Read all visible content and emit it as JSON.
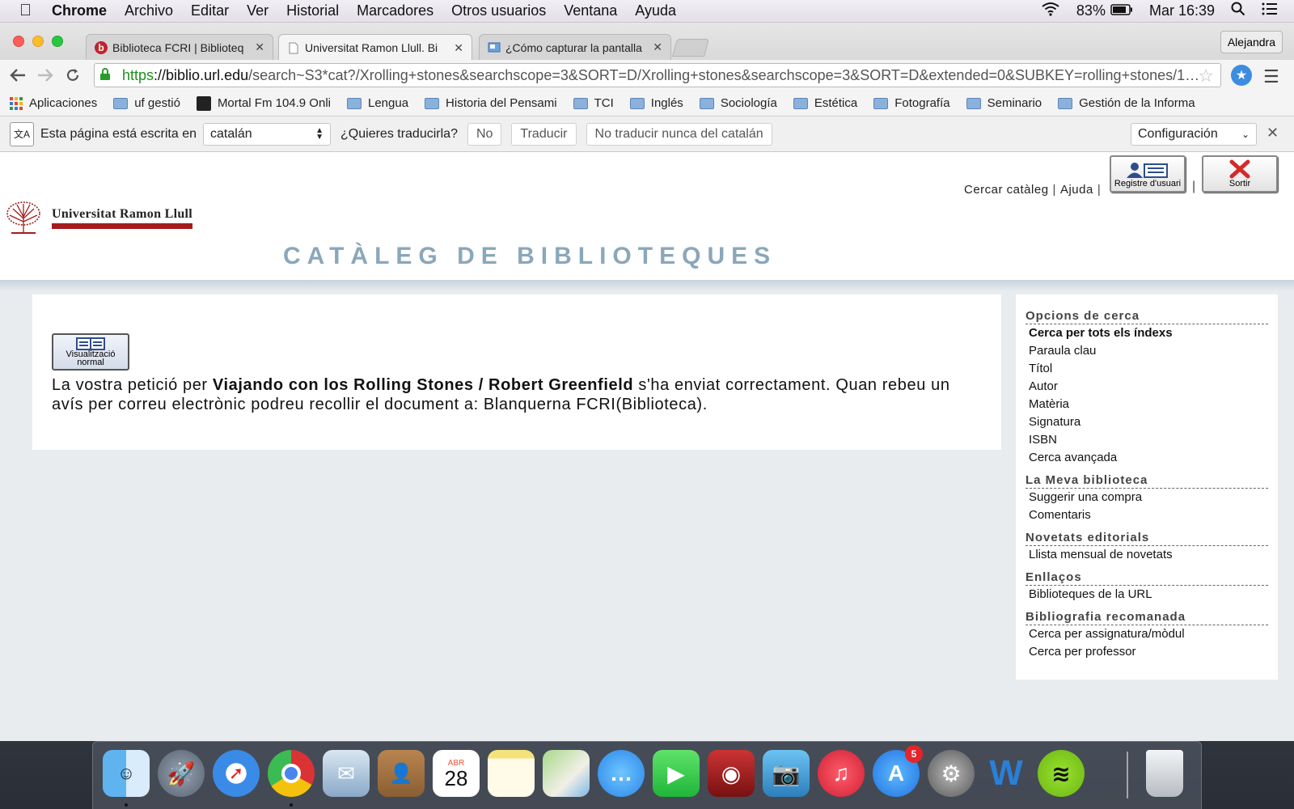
{
  "menubar": {
    "app": "Chrome",
    "items": [
      "Archivo",
      "Editar",
      "Ver",
      "Historial",
      "Marcadores",
      "Otros usuarios",
      "Ventana",
      "Ayuda"
    ],
    "battery": "83%",
    "clock": "Mar 16:39"
  },
  "tabs": [
    {
      "title": "Biblioteca FCRI | Biblioteq",
      "favicon": "b"
    },
    {
      "title": "Universitat Ramon Llull. Bi",
      "favicon": ""
    },
    {
      "title": "¿Cómo capturar la pantalla",
      "favicon": ""
    }
  ],
  "user": "Alejandra",
  "omnibox": {
    "scheme": "https",
    "host": "://biblio.url.edu",
    "path": "/search~S3*cat?/Xrolling+stones&searchscope=3&SORT=D/Xrolling+stones&searchscope=3&SORT=D&extended=0&SUBKEY=rolling+stones/1…"
  },
  "bookmarks": {
    "apps": "Aplicaciones",
    "items": [
      "uf gestió",
      "Mortal Fm 104.9 Onli",
      "Lengua",
      "Historia del Pensami",
      "TCI",
      "Inglés",
      "Sociología",
      "Estética",
      "Fotografía",
      "Seminario",
      "Gestión de la Informa"
    ]
  },
  "translate": {
    "prefix": "Esta página está escrita en",
    "language": "catalán",
    "question": "¿Quieres traducirla?",
    "no": "No",
    "translate": "Traducir",
    "never": "No traducir nunca del catalán",
    "config": "Configuración"
  },
  "header": {
    "search_link": "Cercar catàleg",
    "help_link": "Ajuda",
    "register_label": "Registre d'usuari",
    "exit_label": "Sortir",
    "university": "Universitat Ramon Llull",
    "catalog_title": "CATÀLEG DE BIBLIOTEQUES"
  },
  "main": {
    "view_label_1": "Visualització",
    "view_label_2": "normal",
    "msg_prefix": "La vostra petició per",
    "msg_title": "Viajando con los Rolling Stones / Robert Greenfield",
    "msg_suffix": "s'ha enviat correctament. Quan rebeu un avís per correu electrònic podreu recollir el document a: Blanquerna FCRI(Biblioteca)."
  },
  "sidebar": {
    "sections": [
      {
        "title": "Opcions de cerca",
        "items": [
          "Cerca per tots els índexs",
          "Paraula clau",
          "Títol",
          "Autor",
          "Matèria",
          "Signatura",
          "ISBN",
          "Cerca avançada"
        ]
      },
      {
        "title": "La Meva biblioteca",
        "items": [
          "Suggerir una compra",
          "Comentaris"
        ]
      },
      {
        "title": "Novetats editorials",
        "items": [
          "Llista mensual de novetats"
        ]
      },
      {
        "title": "Enllaços",
        "items": [
          "Biblioteques de la URL"
        ]
      },
      {
        "title": "Bibliografia recomanada",
        "items": [
          "Cerca per assignatura/mòdul",
          "Cerca per professor"
        ]
      }
    ]
  },
  "dock": {
    "calendar_month": "ABR",
    "calendar_day": "28",
    "appstore_badge": "5",
    "apps": [
      "finder-icon",
      "launchpad-icon",
      "safari-icon",
      "chrome-icon",
      "mail-icon",
      "contacts-icon",
      "calendar-icon",
      "notes-icon",
      "maps-icon",
      "messages-icon",
      "facetime-icon",
      "photobooth-icon",
      "iphoto-icon",
      "itunes-icon",
      "appstore-icon",
      "system-preferences-icon",
      "word-icon",
      "spotify-icon",
      "trash-icon"
    ]
  },
  "colors": {
    "accent_red": "#a41c1c",
    "catalog_title": "#8aa7bb",
    "https_green": "#1b8f1b"
  }
}
